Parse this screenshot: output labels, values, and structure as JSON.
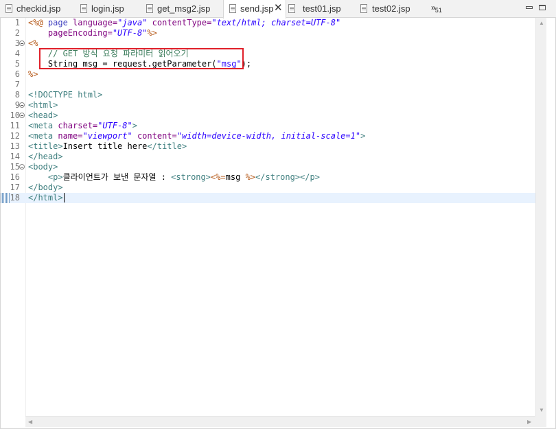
{
  "tabs": [
    {
      "label": "checkid.jsp",
      "active": false
    },
    {
      "label": "login.jsp",
      "active": false
    },
    {
      "label": "get_msg2.jsp",
      "active": false
    },
    {
      "label": "send.jsp",
      "active": true
    },
    {
      "label": "test01.jsp",
      "active": false
    },
    {
      "label": "test02.jsp",
      "active": false
    }
  ],
  "overflow": {
    "symbol": "»",
    "count": "51"
  },
  "close_symbol": "✕",
  "editor": {
    "active_line": 18,
    "lines": [
      {
        "n": "1"
      },
      {
        "n": "2"
      },
      {
        "n": "3"
      },
      {
        "n": "4"
      },
      {
        "n": "5"
      },
      {
        "n": "6"
      },
      {
        "n": "7"
      },
      {
        "n": "8"
      },
      {
        "n": "9"
      },
      {
        "n": "10"
      },
      {
        "n": "11"
      },
      {
        "n": "12"
      },
      {
        "n": "13"
      },
      {
        "n": "14"
      },
      {
        "n": "15"
      },
      {
        "n": "16"
      },
      {
        "n": "17"
      },
      {
        "n": "18"
      }
    ],
    "code": {
      "l1": {
        "open": "<%@",
        "page": " page ",
        "a1": "language=",
        "v1": "\"java\"",
        "a2": " contentType=",
        "v2": "\"text/html; charset=UTF-8\""
      },
      "l2": {
        "a1": "    pageEncoding=",
        "v1": "\"UTF-8\"",
        "close": "%>"
      },
      "l3": {
        "open": "<%"
      },
      "l4": {
        "comment": "    // GET 방식 요청 파라미터 읽어오기"
      },
      "l5": {
        "t1": "    String msg = request.getParameter(",
        "s": "\"msg\"",
        "t2": ");"
      },
      "l6": {
        "close": "%>"
      },
      "l8": {
        "text": "<!DOCTYPE html>"
      },
      "l9": {
        "text": "<html>"
      },
      "l10": {
        "text": "<head>"
      },
      "l11": {
        "tag": "<meta",
        "a1": " charset=",
        "v1": "\"UTF-8\"",
        "end": ">"
      },
      "l12": {
        "tag": "<meta",
        "a1": " name=",
        "v1": "\"viewport\"",
        "a2": " content=",
        "v2": "\"width=device-width, initial-scale=1\"",
        "end": ">"
      },
      "l13": {
        "tag": "<title>",
        "text": "Insert title here",
        "end": "</title>"
      },
      "l14": {
        "text": "</head>"
      },
      "l15": {
        "text": "<body>"
      },
      "l16": {
        "indent": "    ",
        "tag": "<p>",
        "text": "클라이언트가 보낸 문자열 : ",
        "strong": "<strong>",
        "jsp": "<%=",
        "expr": "msg ",
        "jspclose": "%>",
        "strongclose": "</strong>",
        "pclose": "</p>"
      },
      "l17": {
        "text": "</body>"
      },
      "l18": {
        "text": "</html>"
      }
    }
  }
}
